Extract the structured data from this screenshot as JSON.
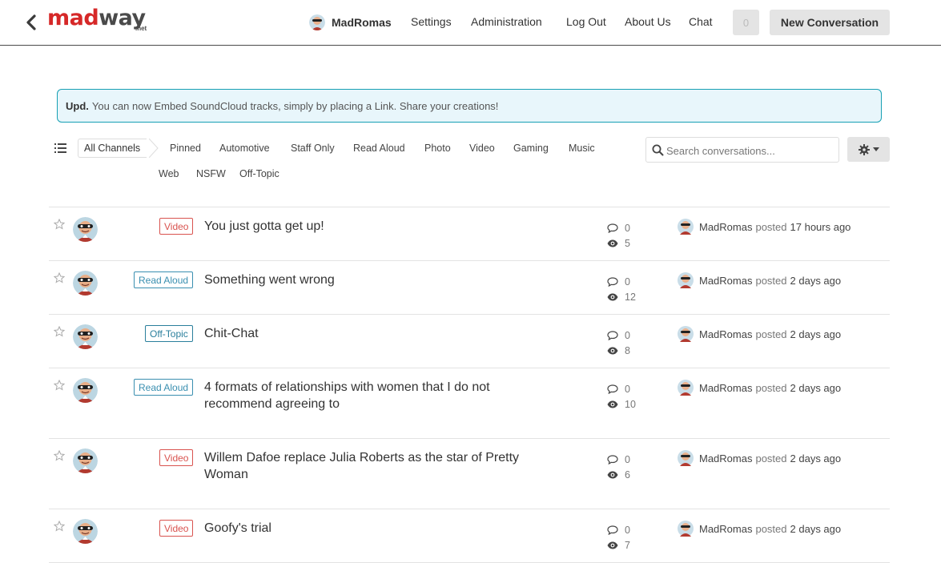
{
  "header": {
    "logo_main_a": "mad",
    "logo_main_b": "way",
    "logo_sub": ".net",
    "user_name": "MadRomas",
    "nav": [
      "Settings",
      "Administration",
      "Log Out",
      "About Us",
      "Chat"
    ],
    "notification_count": "0",
    "new_conversation_label": "New Conversation"
  },
  "notice": {
    "label": "Upd.",
    "text": "You can now Embed SoundCloud tracks, simply by placing a Link. Share your creations!"
  },
  "channels": {
    "active": "All Channels",
    "items": [
      "Pinned",
      "Automotive",
      "Staff Only",
      "Read Aloud",
      "Photo",
      "Video",
      "Gaming",
      "Music",
      "Web",
      "NSFW",
      "Off-Topic"
    ]
  },
  "search": {
    "placeholder": "Search conversations..."
  },
  "colors": {
    "accent_red": "#d62828",
    "notice_border": "#17a0b4",
    "tag_video": "#d9534f",
    "tag_read_aloud": "#3a8fb0"
  },
  "conversations": [
    {
      "channel": "Video",
      "title": "You just gotta get up!",
      "replies": "0",
      "views": "5",
      "author": "MadRomas",
      "posted": "posted",
      "time": "17 hours ago"
    },
    {
      "channel": "Read Aloud",
      "title": "Something went wrong",
      "replies": "0",
      "views": "12",
      "author": "MadRomas",
      "posted": "posted",
      "time": "2 days ago"
    },
    {
      "channel": "Off-Topic",
      "title": "Chit-Chat",
      "replies": "0",
      "views": "8",
      "author": "MadRomas",
      "posted": "posted",
      "time": "2 days ago"
    },
    {
      "channel": "Read Aloud",
      "title": "4 formats of relationships with women that I do not recommend agreeing to",
      "replies": "0",
      "views": "10",
      "author": "MadRomas",
      "posted": "posted",
      "time": "2 days ago"
    },
    {
      "channel": "Video",
      "title": "Willem Dafoe replace Julia Roberts as the star of Pretty Woman",
      "replies": "0",
      "views": "6",
      "author": "MadRomas",
      "posted": "posted",
      "time": "2 days ago"
    },
    {
      "channel": "Video",
      "title": "Goofy's trial",
      "replies": "0",
      "views": "7",
      "author": "MadRomas",
      "posted": "posted",
      "time": "2 days ago"
    }
  ]
}
